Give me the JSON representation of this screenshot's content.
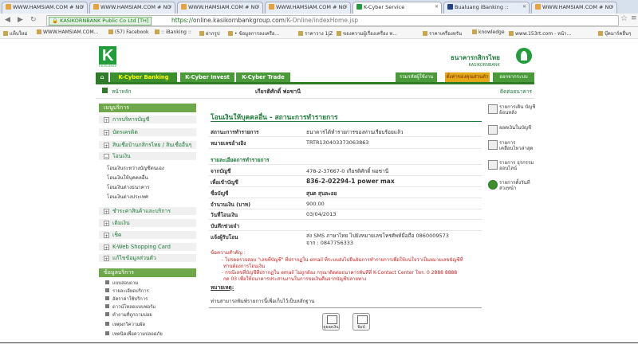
{
  "browser": {
    "tabs": [
      {
        "title": "WWW.HAMSIAM.COM # NO"
      },
      {
        "title": "WWW.HAMSIAM.COM # NO"
      },
      {
        "title": "WWW.HAMSIAM.COM # NO"
      },
      {
        "title": "WWW.HAMSIAM.COM # NO"
      },
      {
        "title": "K-Cyber Service"
      },
      {
        "title": "Bualuang iBanking ::"
      },
      {
        "title": "WWW.HAMSIAM.COM # NO"
      }
    ],
    "security_label": "KASIKORNBANK Public Co Ltd [TH]",
    "url_scheme": "https://",
    "url_host": "online.kasikornbankgroup.com",
    "url_path": "/K-Online/indexHome.jsp",
    "bookmarks": [
      "แท็บใหม่",
      "WWW.HAMSIAM.COM...",
      "(57) Facebook",
      ":: iBanking ::",
      "ฝากรูป",
      "• ข้อมูลการลงเครือ...",
      "ราคาวาง 1JZ",
      "ของความผู้เรื่องเครื่อง ท...",
      "ราคาเครื่องทรัน",
      "knowledge",
      "www.153rt.com - หน้า...",
      "บุ๊คมาร์คอื่นๆ"
    ]
  },
  "header": {
    "logo_letter": "K",
    "logo_tag": "EXCELLENCE",
    "bank_name_th": "ธนาคารกสิกรไทย",
    "bank_name_en": "KASIKORNBANK"
  },
  "nav": {
    "tabs": [
      "K-Cyber Banking",
      "K-Cyber Invest",
      "K-Cyber Trade"
    ],
    "right_tabs": [
      "รวมรหัสผู้ใช้งาน",
      "ตั้งค่าของคุณส่วนตัว",
      "ออกจากระบบ"
    ],
    "home_link": "หน้าหลัก",
    "user_name": "เกียรติศักดิ์ พ่อชานี",
    "logout_link": "ติดต่อธนาคาร"
  },
  "sidebar": {
    "header": "เมนูบริการ",
    "items": [
      "การบริหารบัญชี",
      "บัตรเครดิต",
      "สินเชื่อบ้านกสิกรไทย / สินเชื่ออื่นๆ",
      "โอนเงิน",
      "ชำระค่าสินค้าและบริการ",
      "เติมเงิน",
      "เช็ค",
      "K-Web Shopping Card",
      "แก้ไขข้อมูลส่วนตัว"
    ],
    "transfer_sub": [
      "โอนเงินระหว่างบัญชีตนเอง",
      "โอนเงินให้บุคคลอื่น",
      "โอนเงินต่างธนาคาร",
      "โอนเงินต่างประเทศ"
    ],
    "utility_header": "ข้อมูลบริการ",
    "utilities": [
      "แบบสอบถาม",
      "รายละเอียดบริการ",
      "อัตราค่าใช้บริการ",
      "ดาวน์โหลดแบบฟอร์ม",
      "คำถามที่ถูกถามบ่อย",
      "เหตุผกวิความผัด",
      "เทคนิคเพื่อความปลอดภัย"
    ]
  },
  "main": {
    "title": "โอนเงินให้บุคคลอื่น - สถานะการทำรายการ",
    "status_label": "สถานะการทำรายการ",
    "status_value": "ธนาคารได้ทำรายการของท่านเรียบร้อยแล้ว",
    "ref_label": "หมายเลขอ้างอิง",
    "ref_value": "TRTR130403373063863",
    "details_header": "รายละเอียดการทำรายการ",
    "from_label": "จากบัญชี",
    "from_value": "478-2-37667-0 เกียรติศักดิ์ พ่อชานี",
    "to_label": "เพื่อเข้าบัญชี",
    "to_value": "836-2-02294-1 power max",
    "name_label": "ชื่อบัญชี",
    "name_value": "สุนต สุนละอย",
    "amount_label": "จำนวนเงิน (บาท)",
    "amount_value": "900.00",
    "date_label": "วันที่โอนเงิน",
    "date_value": "03/04/2013",
    "memo_label": "บันทึกช่วยจำ",
    "notify_label": "แจ้งผู้รับโอน",
    "notify_line1": "ส่ง SMS ภาษาไทย ไปยังหมายเลขโทรศัพท์มือถือ 0860009573",
    "notify_line2": "จาก : 0847756333",
    "warning_header": "ข้อความสำคัญ :",
    "warning_lines": [
      "- โปรดตรวจสอบ \"เลขที่บัญชี\" ที่ปรากฏใน email ที่ระบบส่งไปยืนยันการทำรายการเพื่อให้แน่ใจว่าเป็นหมายเลขบัญชีที่",
      "ท่านต้องการโอนเงิน",
      "- กรณีเลขที่บัญชีที่ปรากฏใน email ไม่ถูกต้อง กรุณาติดต่อธนาคารทันทีที่ K-Contact Center โทร. 0 2888 8888",
      "กด 03 เพื่อให้ธนาคารประสานงานในการขอเงินคืนจากบัญชีปลายทาง"
    ],
    "note_header": "หมายเหตุ:",
    "note_text": "ท่านสามารถพิมพ์รายการนี้เพื่อเก็บไว้เป็นหลักฐาน",
    "buttons": [
      "ดูยอดเงิน",
      "พิมพ์"
    ]
  },
  "right_sidebar": [
    "รายการเดิน บัญชีย้อนหลัง",
    "ยอดเงินในบัญชี",
    "รายการ เคลื่อนไหวล่าสุด",
    "รายการ ธุรกรรมออนไลน์",
    "รายการตั้งวันที่ ล่วงหน้า"
  ],
  "colors": {
    "brand": "#1f9e3b",
    "brand_dark": "#2e7d26",
    "warning": "#cc2222"
  }
}
